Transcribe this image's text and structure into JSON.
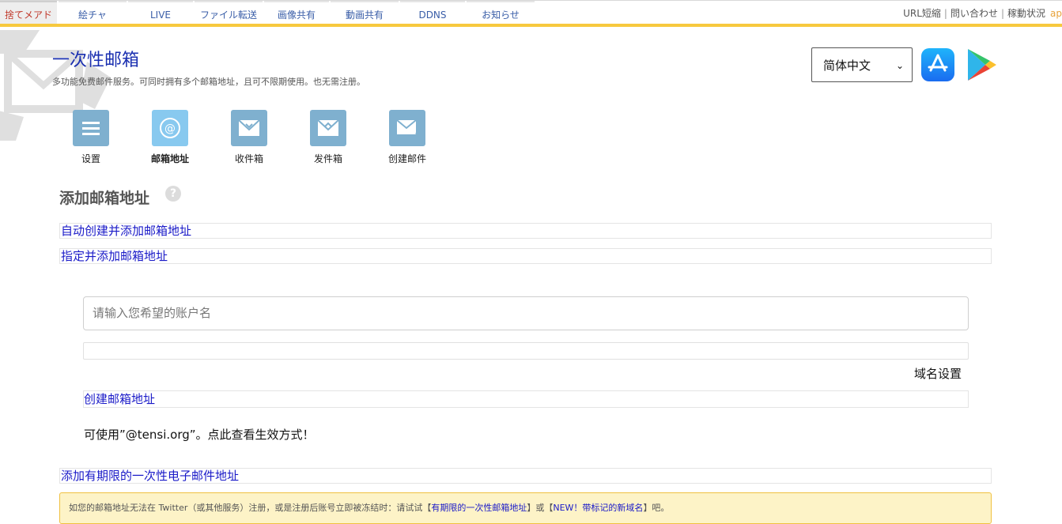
{
  "nav": {
    "tabs": [
      "捨てメアド",
      "絵チャ",
      "LIVE",
      "ファイル転送",
      "画像共有",
      "動画共有",
      "DDNS",
      "お知らせ"
    ],
    "right_links": [
      "URL短縮",
      "問い合わせ",
      "稼動状況"
    ],
    "right_extra": "ap"
  },
  "header": {
    "title": "一次性邮箱",
    "subtitle": "多功能免费邮件服务。可同时拥有多个邮箱地址，且可不限期使用。也无需注册。",
    "language": "简体中文"
  },
  "menu": [
    {
      "label": "设置",
      "icon": "menu-icon"
    },
    {
      "label": "邮箱地址",
      "icon": "at-icon"
    },
    {
      "label": "收件箱",
      "icon": "inbox-icon"
    },
    {
      "label": "发件箱",
      "icon": "outbox-icon"
    },
    {
      "label": "创建邮件",
      "icon": "compose-mail-icon"
    }
  ],
  "section": {
    "title": "添加邮箱地址",
    "help": "?",
    "auto_create": "自动创建并添加邮箱地址",
    "specify_add": "指定并添加邮箱地址",
    "input_placeholder": "请输入您希望的账户名",
    "domain_settings": "域名设置",
    "create_button": "创建邮箱地址",
    "available_text": "可使用”@tensi.org”。点此查看生效方式！",
    "limited_add": "添加有期限的一次性电子邮件地址"
  },
  "notice": {
    "prefix": "如您的邮箱地址无法在 Twitter（或其他服务）注册，或是注册后账号立即被冻结时：请试试【",
    "link1": "有期限的一次性邮箱地址",
    "mid": "】或【",
    "link2": "NEW！带标记的新域名",
    "suffix": "】吧。"
  },
  "colors": {
    "accent_yellow": "#f7c93e",
    "link_blue": "#1a1ac8",
    "menu_icon_bg": "#7fb0cf"
  }
}
